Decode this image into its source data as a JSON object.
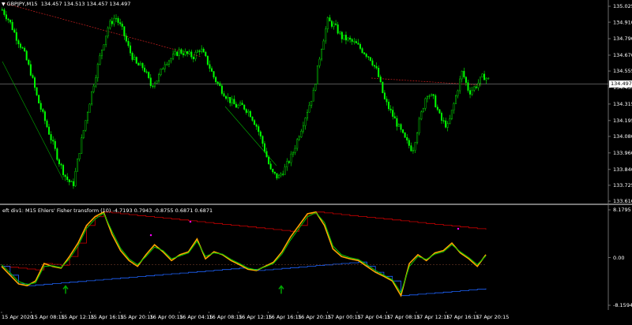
{
  "main_header": {
    "symbol_label": "GBPJPY,M15",
    "ohlc": "134.457 134.513 134.457 134.497"
  },
  "indicator_header": "eft div1: M15 Ehlers' Fisher transform (10) -4.7193 0.7943 -0.8755 0.6871 0.6871",
  "price_axis": {
    "ticks": [
      "135.025",
      "134.910",
      "134.790",
      "134.670",
      "134.555",
      "134.435",
      "134.315",
      "134.195",
      "134.080",
      "133.960",
      "133.840",
      "133.725",
      "133.610"
    ],
    "current_price": "134.497"
  },
  "indicator_axis": {
    "ticks": [
      "8.1795",
      "0.00",
      "-8.1594"
    ]
  },
  "time_axis": {
    "labels": [
      "15 Apr 2020",
      "15 Apr 08:15",
      "15 Apr 12:15",
      "15 Apr 16:15",
      "15 Apr 20:15",
      "16 Apr 00:15",
      "16 Apr 04:15",
      "16 Apr 08:15",
      "16 Apr 12:15",
      "16 Apr 16:15",
      "16 Apr 20:15",
      "17 Apr 00:15",
      "17 Apr 04:15",
      "17 Apr 08:15",
      "17 Apr 12:15",
      "17 Apr 16:15",
      "17 Apr 20:15"
    ]
  },
  "colors": {
    "background": "#000000",
    "candles": "#00ff00",
    "fisher_main": "#ffa500",
    "fisher_signal": "#00cc00",
    "upper_band": "#cc0000",
    "lower_band": "#1e64ff",
    "arrow": "#00aa00",
    "dot": "#ff00ff",
    "current_price_line": "#c8c8c8"
  },
  "chart_data": [
    {
      "type": "candlestick",
      "title": "GBPJPY,M15",
      "ylim": [
        133.61,
        135.025
      ],
      "close_series": [
        135.0,
        134.92,
        134.8,
        134.7,
        134.55,
        134.35,
        134.2,
        134.05,
        133.9,
        133.78,
        133.72,
        134.0,
        134.25,
        134.48,
        134.7,
        134.88,
        134.95,
        134.85,
        134.7,
        134.6,
        134.58,
        134.45,
        134.5,
        134.62,
        134.65,
        134.7,
        134.68,
        134.66,
        134.72,
        134.62,
        134.5,
        134.42,
        134.35,
        134.3,
        134.3,
        134.25,
        134.15,
        134.0,
        133.82,
        133.78,
        133.85,
        133.95,
        134.1,
        134.25,
        134.4,
        134.7,
        134.92,
        134.88,
        134.8,
        134.78,
        134.75,
        134.7,
        134.65,
        134.55,
        134.35,
        134.25,
        134.15,
        134.05,
        133.98,
        134.2,
        134.4,
        134.35,
        134.2,
        134.15,
        134.35,
        134.55,
        134.4,
        134.45,
        134.52,
        134.48
      ],
      "current_price": 134.497
    },
    {
      "type": "line",
      "title": "eft div1: M15 Ehlers' Fisher transform (10)",
      "ylim": [
        -8.1594,
        8.1795
      ],
      "series": [
        {
          "name": "fisher",
          "values": [
            -1.5,
            -3.0,
            -4.5,
            -4.8,
            -4.0,
            -1.0,
            -1.5,
            -1.8,
            0.2,
            2.5,
            5.5,
            7.0,
            7.8,
            4.0,
            1.2,
            -0.5,
            -1.5,
            0.5,
            2.2,
            1.0,
            -0.5,
            0.5,
            1.0,
            3.2,
            -0.2,
            1.0,
            0.5,
            -0.5,
            -1.2,
            -2.0,
            -2.2,
            -1.5,
            -0.8,
            1.0,
            3.5,
            5.5,
            7.5,
            7.8,
            5.5,
            1.5,
            0.2,
            -0.2,
            -0.5,
            -1.5,
            -2.5,
            -3.2,
            -4.0,
            -6.5,
            -1.0,
            0.5,
            -0.5,
            0.8,
            1.2,
            2.5,
            0.8,
            -0.2,
            -1.5,
            0.5
          ]
        },
        {
          "name": "signal",
          "values": [
            -1.2,
            -2.6,
            -4.1,
            -4.6,
            -4.3,
            -1.5,
            -1.4,
            -1.7,
            -0.2,
            2.0,
            5.0,
            6.6,
            7.6,
            4.5,
            1.6,
            -0.2,
            -1.2,
            0.2,
            1.8,
            1.2,
            -0.2,
            0.3,
            0.8,
            2.8,
            0.2,
            0.8,
            0.6,
            -0.3,
            -1.0,
            -1.8,
            -2.1,
            -1.6,
            -1.0,
            0.6,
            3.0,
            5.0,
            7.0,
            7.7,
            6.0,
            2.0,
            0.5,
            0.0,
            -0.3,
            -1.2,
            -2.2,
            -3.0,
            -3.8,
            -6.0,
            -1.5,
            0.2,
            -0.3,
            0.6,
            1.0,
            2.2,
            1.0,
            0.0,
            -1.2,
            0.3
          ]
        }
      ]
    }
  ]
}
